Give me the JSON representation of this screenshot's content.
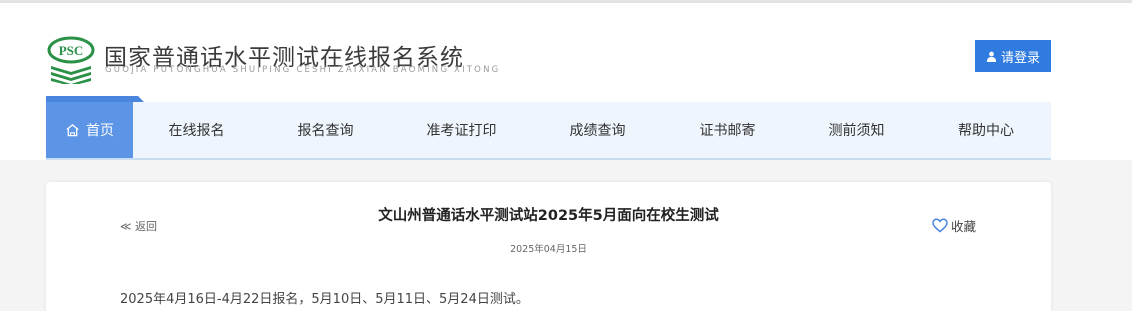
{
  "header": {
    "logo_text": "PSC",
    "site_title": "国家普通话水平测试在线报名系统",
    "site_subtitle": "GUOJIA PUTONGHUA SHUIPING CESHI ZAIXIAN BAOMING XITONG",
    "login_label": "请登录",
    "brand_color": "#2a9147",
    "accent_color": "#2f7be0"
  },
  "nav": {
    "items": [
      {
        "label": "首页",
        "icon": "home-icon",
        "active": true
      },
      {
        "label": "在线报名"
      },
      {
        "label": "报名查询"
      },
      {
        "label": "准考证打印"
      },
      {
        "label": "成绩查询"
      },
      {
        "label": "证书邮寄"
      },
      {
        "label": "测前须知"
      },
      {
        "label": "帮助中心"
      }
    ]
  },
  "article": {
    "back_label": "≪ 返回",
    "title": "文山州普通话水平测试站2025年5月面向在校生测试",
    "date": "2025年04月15日",
    "favorite_label": "收藏",
    "body": "2025年4月16日-4月22日报名，5月10日、5月11日、5月24日测试。"
  }
}
